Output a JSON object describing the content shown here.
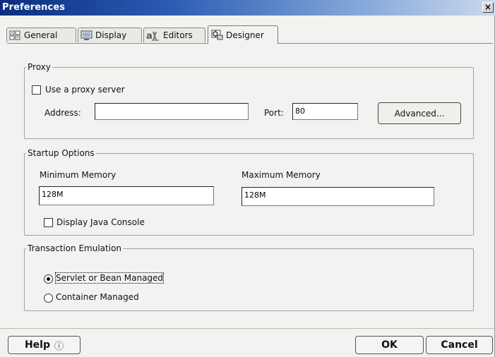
{
  "window": {
    "title": "Preferences",
    "close_glyph": "×"
  },
  "tabs": [
    {
      "label": "General",
      "icon": "general-icon"
    },
    {
      "label": "Display",
      "icon": "display-icon"
    },
    {
      "label": "Editors",
      "icon": "editors-icon"
    },
    {
      "label": "Designer",
      "icon": "designer-icon",
      "active": true
    }
  ],
  "proxy": {
    "legend": "Proxy",
    "use_proxy_label": "Use a proxy server",
    "use_proxy_checked": false,
    "address_label": "Address:",
    "address_value": "",
    "port_label": "Port:",
    "port_value": "80",
    "advanced_label": "Advanced..."
  },
  "startup": {
    "legend": "Startup Options",
    "min_label": "Minimum Memory",
    "min_value": "128M",
    "max_label": "Maximum Memory",
    "max_value": "128M",
    "java_console_label": "Display Java Console",
    "java_console_checked": false
  },
  "transaction": {
    "legend": "Transaction Emulation",
    "options": [
      {
        "label": "Servlet or Bean Managed",
        "checked": true
      },
      {
        "label": "Container Managed",
        "checked": false
      }
    ]
  },
  "footer": {
    "help_label": "Help",
    "help_icon": "ⓘ",
    "ok_label": "OK",
    "cancel_label": "Cancel"
  }
}
